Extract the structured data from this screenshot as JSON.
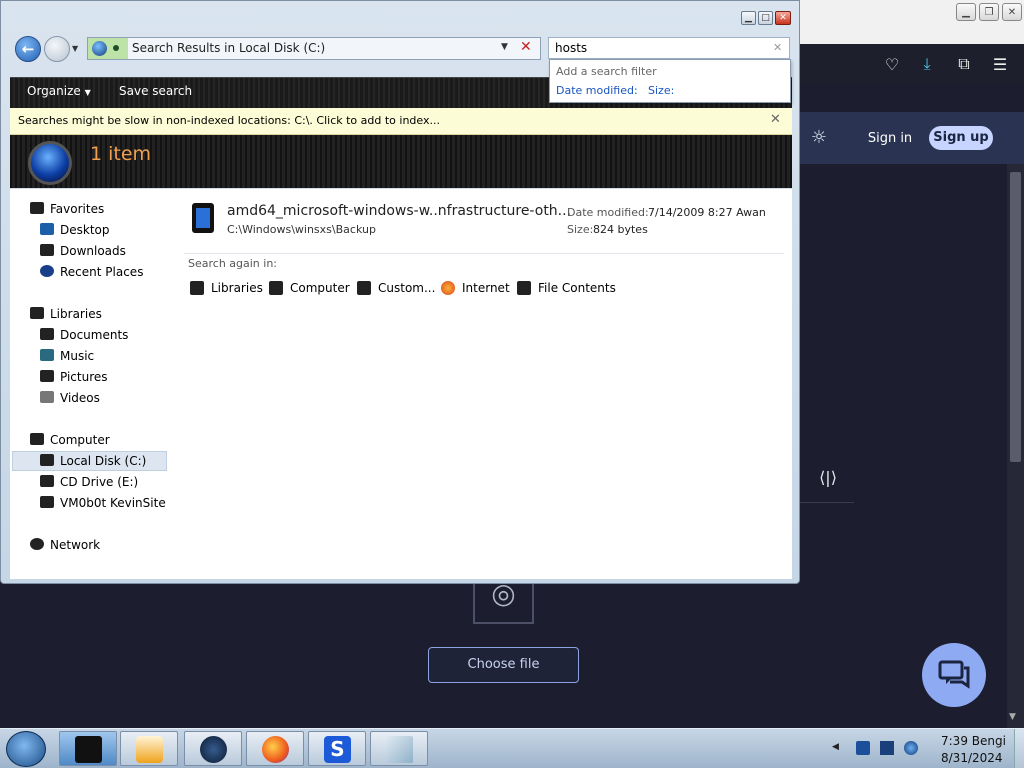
{
  "explorer": {
    "address": "Search Results in Local Disk (C:)",
    "search_query": "hosts",
    "filter_popup": {
      "title": "Add a search filter",
      "date_modified": "Date modified:",
      "size": "Size:"
    },
    "toolbar": {
      "organize": "Organize",
      "save_search": "Save search"
    },
    "info_bar": "Searches might be slow in non-indexed locations: C:\\. Click to add to index...",
    "item_count": "1 item",
    "nav": {
      "favorites": "Favorites",
      "desktop": "Desktop",
      "downloads": "Downloads",
      "recent_places": "Recent Places",
      "libraries": "Libraries",
      "documents": "Documents",
      "music": "Music",
      "pictures": "Pictures",
      "videos": "Videos",
      "computer": "Computer",
      "local_disk": "Local Disk (C:)",
      "cd_drive": "CD Drive (E:)",
      "network_share": "VM0b0t KevinSite",
      "network": "Network"
    },
    "result": {
      "name": "amd64_microsoft-windows-w..nfrastructure-oth...",
      "path": "C:\\Windows\\winsxs\\Backup",
      "date_label": "Date modified:",
      "date_value": "7/14/2009 8:27 Awan",
      "size_label": "Size:",
      "size_value": "824 bytes"
    },
    "search_again": {
      "label": "Search again in:",
      "items": [
        "Libraries",
        "Computer",
        "Custom...",
        "Internet",
        "File Contents"
      ]
    }
  },
  "browser": {
    "sign_in": "Sign in",
    "sign_up": "Sign up",
    "choose_file": "Choose file",
    "colors": {
      "background": "#1c1e30",
      "accent": "#c7d4ff",
      "chat": "#8eaaf3"
    }
  },
  "taskbar": {
    "time": "7:39 Bengi",
    "date": "8/31/2024"
  }
}
